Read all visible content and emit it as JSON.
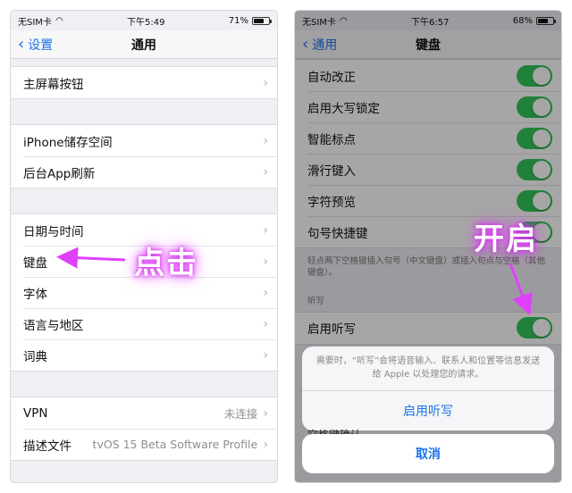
{
  "left": {
    "status": {
      "carrier": "无SIM卡",
      "time": "下午5:49",
      "battery": "71%",
      "battery_level": 0.71
    },
    "nav": {
      "back": "设置",
      "title": "通用"
    },
    "groups": [
      [
        "主屏幕按钮"
      ],
      [
        "iPhone储存空间",
        "后台App刷新"
      ],
      [
        "日期与时间",
        "键盘",
        "字体",
        "语言与地区",
        "词典"
      ]
    ],
    "vpn": {
      "label": "VPN",
      "value": "未连接"
    },
    "profile": {
      "label": "描述文件",
      "value": "tvOS 15 Beta Software Profile"
    }
  },
  "right": {
    "status": {
      "carrier": "无SIM卡",
      "time": "下午6:57",
      "battery": "68%",
      "battery_level": 0.68
    },
    "nav": {
      "back": "通用",
      "title": "键盘"
    },
    "toggles": [
      "自动改正",
      "启用大写锁定",
      "智能标点",
      "滑行键入",
      "字符预览",
      "句号快捷键"
    ],
    "footnote": "轻点两下空格键插入句号（中文键盘）或插入句点与空格（其他键盘）。",
    "dictation_header": "听写",
    "dictation_label": "启用听写",
    "sheet": {
      "message": "需要时，“听写”会将语音输入、联系人和位置等信息发送给 Apple 以处理您的请求。",
      "action": "启用听写",
      "peek": "空格键确认",
      "cancel": "取消"
    }
  },
  "annotations": {
    "click": "点击",
    "open": "开启"
  },
  "colors": {
    "accent": "#1a73e8",
    "toggle_on": "#34c759",
    "annotation": "#e040fb"
  }
}
